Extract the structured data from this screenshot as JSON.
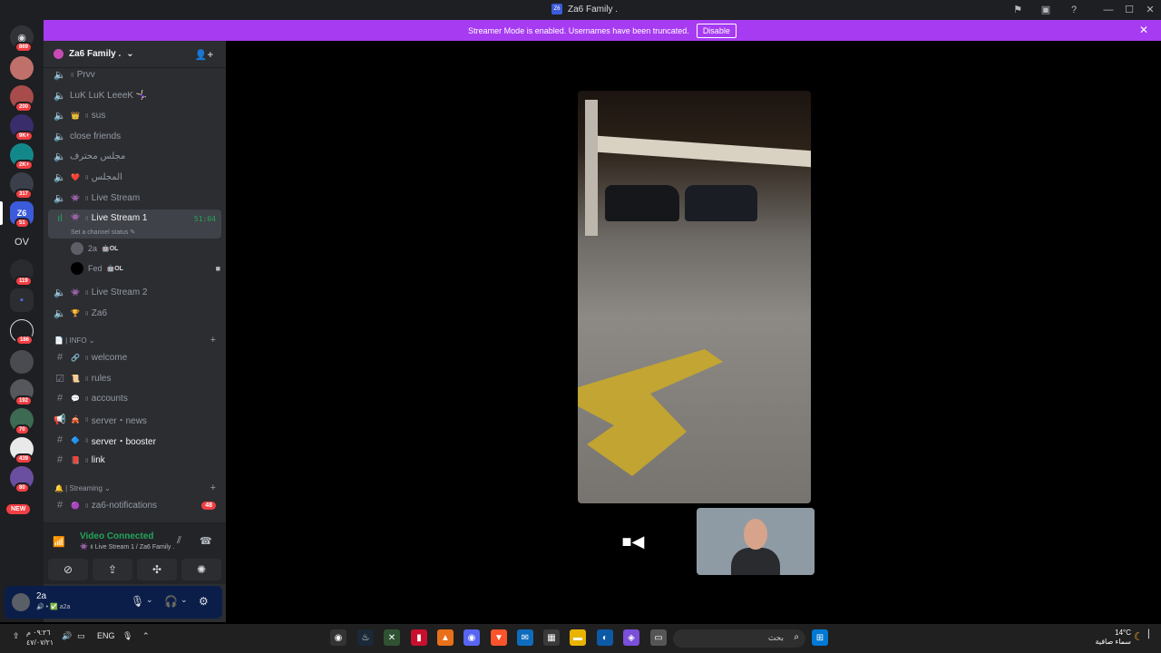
{
  "window": {
    "title": "Za6 Family .",
    "app_icon_text": "Z6"
  },
  "banner": {
    "text": "Streamer Mode is enabled. Usernames have been truncated.",
    "disable_label": "Disable",
    "close": "✕"
  },
  "rail": {
    "servers": [
      {
        "badge": "869",
        "label": ""
      },
      {
        "badge": "",
        "label": ""
      },
      {
        "badge": "200",
        "label": ""
      },
      {
        "badge": "9K+",
        "label": ""
      },
      {
        "badge": "2K+",
        "label": ""
      },
      {
        "badge": "317",
        "label": ""
      },
      {
        "badge": "51",
        "label": "Z6"
      },
      {
        "badge": "",
        "label": "OV"
      },
      {
        "badge": "119",
        "label": ""
      },
      {
        "badge": "",
        "label": ""
      },
      {
        "badge": "186",
        "label": ""
      },
      {
        "badge": "",
        "label": ""
      },
      {
        "badge": "192",
        "label": ""
      },
      {
        "badge": "70",
        "label": ""
      },
      {
        "badge": "439",
        "label": ""
      },
      {
        "badge": "80",
        "label": ""
      }
    ],
    "new_label": "NEW"
  },
  "sidebar": {
    "server_name": "Za6 Family .",
    "channels": [
      {
        "name": "Prvv",
        "emoji": "",
        "sep": "॥"
      },
      {
        "name": "LuK LuK LeeeK 🤸🏻‍♀️",
        "emoji": "",
        "sep": ""
      },
      {
        "name": "sus",
        "emoji": "👑",
        "sep": "॥"
      },
      {
        "name": "close friends",
        "emoji": "",
        "sep": ""
      },
      {
        "name": "مجلس محترف",
        "emoji": "",
        "sep": ""
      },
      {
        "name": "المجلس",
        "emoji": "❤️",
        "sep": "॥"
      },
      {
        "name": "Live Stream",
        "emoji": "👾",
        "sep": "॥"
      }
    ],
    "active_channel": {
      "name": "Live Stream 1",
      "emoji": "👾",
      "sep": "॥",
      "timer": "51:04",
      "status": "Set a channel status ✎"
    },
    "voice_users": [
      {
        "name": "2a",
        "tag": "🤖OL"
      },
      {
        "name": "Fed",
        "tag": "🤖OL"
      }
    ],
    "channels_after": [
      {
        "name": "Live Stream 2",
        "emoji": "👾",
        "sep": "॥"
      },
      {
        "name": "Za6",
        "emoji": "🏆",
        "sep": "॥"
      }
    ],
    "info_category": "📄 | INFO ⌄",
    "info_channels": [
      {
        "name": "welcome",
        "emoji": "🔗",
        "sep": "॥"
      },
      {
        "name": "rules",
        "emoji": "📜",
        "sep": "॥"
      },
      {
        "name": "accounts",
        "emoji": "💬",
        "sep": "॥"
      },
      {
        "name": "server・news",
        "emoji": "🎪",
        "sep": "॥"
      },
      {
        "name": "server・booster",
        "emoji": "🔷",
        "sep": "॥"
      },
      {
        "name": "link",
        "emoji": "📕",
        "sep": "॥"
      }
    ],
    "streaming_category": "🔔 | Streaming ⌄",
    "streaming_channels": [
      {
        "name": "za6-notifications",
        "emoji": "🟣",
        "sep": "॥",
        "unread": "48"
      }
    ]
  },
  "voice_panel": {
    "title": "Video Connected",
    "subtitle": "👾 ॥ Live Stream 1 / Za6 Family ."
  },
  "user_panel": {
    "name": "2a",
    "sub": "🔊 • ✅ a2a"
  },
  "taskbar": {
    "time": "٠٩:٢٦ م",
    "date": "٤٧/٠٧/٢١",
    "lang": "ENG",
    "search_placeholder": "بحث",
    "temp": "14°C",
    "weather": "سماء صافية"
  },
  "colors": {
    "accent": "#a73bf2",
    "green": "#23a55a",
    "red": "#f23f43"
  }
}
